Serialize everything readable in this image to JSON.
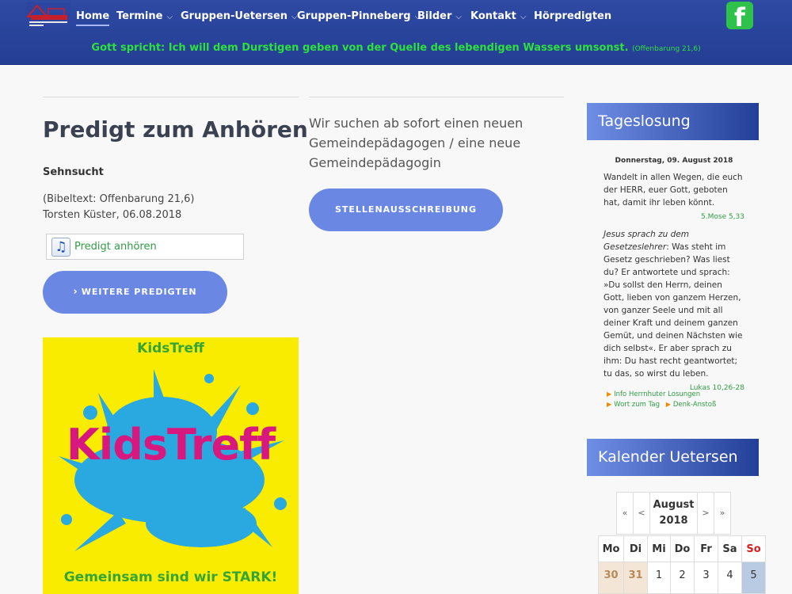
{
  "header": {
    "nav": [
      {
        "label": "Home",
        "dropdown": false
      },
      {
        "label": "Termine",
        "dropdown": true
      },
      {
        "label": "Gruppen-Uetersen",
        "dropdown": true
      },
      {
        "label": "Gruppen-Pinneberg",
        "dropdown": true
      },
      {
        "label": "Bilder",
        "dropdown": true
      },
      {
        "label": "Kontakt",
        "dropdown": true
      },
      {
        "label": "Hörpredigten",
        "dropdown": false
      }
    ],
    "facebook_icon": "facebook-icon",
    "chevron_icon": "⌵",
    "verse": "Gott spricht: Ich will dem Durstigen geben von der Quelle des lebendigen Wassers umsonst.",
    "verse_ref": "(Offenbarung 21,6)"
  },
  "predigt": {
    "title": "Predigt zum Anhören",
    "name": "Sehnsucht",
    "bibeltext": "(Bibeltext: Offenbarung 21,6)",
    "author_date": "Torsten Küster, 06.08.2018",
    "audio_label": "Predigt anhören",
    "more_button": "WEITERE PREDIGTEN"
  },
  "kidstreff": {
    "top": "KidsTreff",
    "big": "KidsTreff",
    "bottom": "Gemeinsam sind wir STARK!"
  },
  "job": {
    "text": "Wir suchen ab sofort einen neuen Gemeindepädagogen / eine neue Gemeindepädagogin",
    "button": "STELLENAUSSCHREIBUNG"
  },
  "tageslosung": {
    "heading": "Tageslosung",
    "date": "Donnerstag, 09. August 2018",
    "losung_text": "Wandelt in allen Wegen, die euch der HERR, euer Gott, geboten hat, damit ihr leben könnt.",
    "losung_ref": "5.Mose 5,33",
    "lehrtext_intro": "Jesus sprach zu dem Gesetzeslehrer",
    "lehrtext": ": Was steht im Gesetz geschrieben? Was liest du? Er antwortete und sprach: »Du sollst den Herrn, deinen Gott, lieben von ganzem Herzen, von ganzer Seele und mit all deiner Kraft und deinem ganzen Gemüt, und deinen Nächsten wie dich selbst«. Er aber sprach zu ihm: Du hast recht geantwortet; tu das, so wirst du leben.",
    "lehrtext_ref": "Lukas 10,26-28",
    "links": [
      "Info Herrnhuter Losungen",
      "Wort zum Tag",
      "Denk-Anstoß"
    ]
  },
  "kalender": {
    "heading": "Kalender Uetersen",
    "nav_first": "«",
    "nav_prev": "<",
    "month": "August",
    "year": "2018",
    "nav_next": ">",
    "nav_last": "»",
    "weekdays": [
      "Mo",
      "Di",
      "Mi",
      "Do",
      "Fr",
      "Sa",
      "So"
    ],
    "first_week": [
      "30",
      "31",
      "1",
      "2",
      "3",
      "4",
      "5"
    ]
  }
}
